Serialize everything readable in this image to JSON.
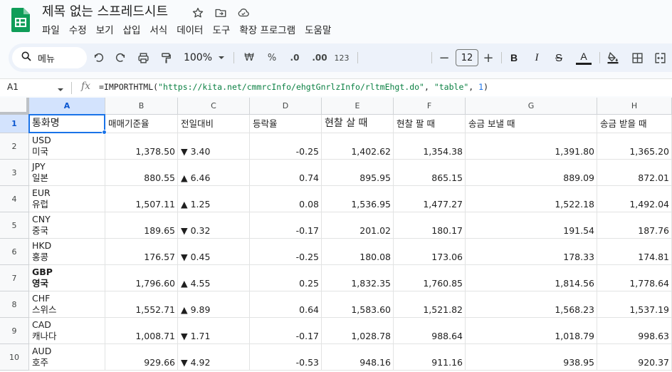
{
  "app": {
    "title": "제목 없는 스프레드시트",
    "icons": [
      "star-icon",
      "move-to-folder-icon",
      "cloud-status-icon"
    ]
  },
  "menu": [
    "파일",
    "수정",
    "보기",
    "삽입",
    "서식",
    "데이터",
    "도구",
    "확장 프로그램",
    "도움말"
  ],
  "toolbar": {
    "search_label": "메뉴",
    "zoom": "100%",
    "currency": "₩",
    "percent": "%",
    "decimal_decrease": ".0",
    "decimal_increase": ".00",
    "number_format": "123",
    "font_size": "12",
    "minus": "−",
    "plus": "+",
    "bold": "B",
    "italic": "I",
    "strike": "S",
    "text_color": "A"
  },
  "formula_bar": {
    "cell_ref": "A1",
    "fx": "fx",
    "formula_prefix": "=IMPORTHTML(",
    "formula_url": "\"https://kita.net/cmmrcInfo/ehgtGnrlzInfo/rltmEhgt.do\"",
    "formula_mid1": ", ",
    "formula_table": "\"table\"",
    "formula_mid2": ", ",
    "formula_index": "1",
    "formula_suffix": ")"
  },
  "grid": {
    "columns": [
      "A",
      "B",
      "C",
      "D",
      "E",
      "F",
      "G",
      "H"
    ],
    "rows": [
      "1",
      "2",
      "3",
      "4",
      "5",
      "6",
      "7",
      "8",
      "9",
      "10"
    ],
    "headers": [
      "통화명",
      "매매기준율",
      "전일대비",
      "등락율",
      "현찰 살 때",
      "현찰 팔 때",
      "송금 보낼 때",
      "송금 받을 때"
    ],
    "data": [
      {
        "code": "USD",
        "name": "미국",
        "base": "1,378.50",
        "change": "▼ 3.40",
        "rate": "-0.25",
        "cash_buy": "1,402.62",
        "cash_sell": "1,354.38",
        "send": "1,391.80",
        "receive": "1,365.20"
      },
      {
        "code": "JPY",
        "name": "일본",
        "base": "880.55",
        "change": "▲ 6.46",
        "rate": "0.74",
        "cash_buy": "895.95",
        "cash_sell": "865.15",
        "send": "889.09",
        "receive": "872.01"
      },
      {
        "code": "EUR",
        "name": "유럽",
        "base": "1,507.11",
        "change": "▲ 1.25",
        "rate": "0.08",
        "cash_buy": "1,536.95",
        "cash_sell": "1,477.27",
        "send": "1,522.18",
        "receive": "1,492.04"
      },
      {
        "code": "CNY",
        "name": "중국",
        "base": "189.65",
        "change": "▼ 0.32",
        "rate": "-0.17",
        "cash_buy": "201.02",
        "cash_sell": "180.17",
        "send": "191.54",
        "receive": "187.76"
      },
      {
        "code": "HKD",
        "name": "홍콩",
        "base": "176.57",
        "change": "▼ 0.45",
        "rate": "-0.25",
        "cash_buy": "180.08",
        "cash_sell": "173.06",
        "send": "178.33",
        "receive": "174.81"
      },
      {
        "code": "GBP",
        "name": "영국",
        "base": "1,796.60",
        "change": "▲ 4.55",
        "rate": "0.25",
        "cash_buy": "1,832.35",
        "cash_sell": "1,760.85",
        "send": "1,814.56",
        "receive": "1,778.64"
      },
      {
        "code": "CHF",
        "name": "스위스",
        "base": "1,552.71",
        "change": "▲ 9.89",
        "rate": "0.64",
        "cash_buy": "1,583.60",
        "cash_sell": "1,521.82",
        "send": "1,568.23",
        "receive": "1,537.19"
      },
      {
        "code": "CAD",
        "name": "캐나다",
        "base": "1,008.71",
        "change": "▼ 1.71",
        "rate": "-0.17",
        "cash_buy": "1,028.78",
        "cash_sell": "988.64",
        "send": "1,018.79",
        "receive": "998.63"
      },
      {
        "code": "AUD",
        "name": "호주",
        "base": "929.66",
        "change": "▼ 4.92",
        "rate": "-0.53",
        "cash_buy": "948.16",
        "cash_sell": "911.16",
        "send": "938.95",
        "receive": "920.37"
      }
    ]
  },
  "colors": {
    "brand_green": "#0f9d58",
    "selection_blue": "#1a73e8",
    "toolbar_bg": "#edf2fa"
  }
}
